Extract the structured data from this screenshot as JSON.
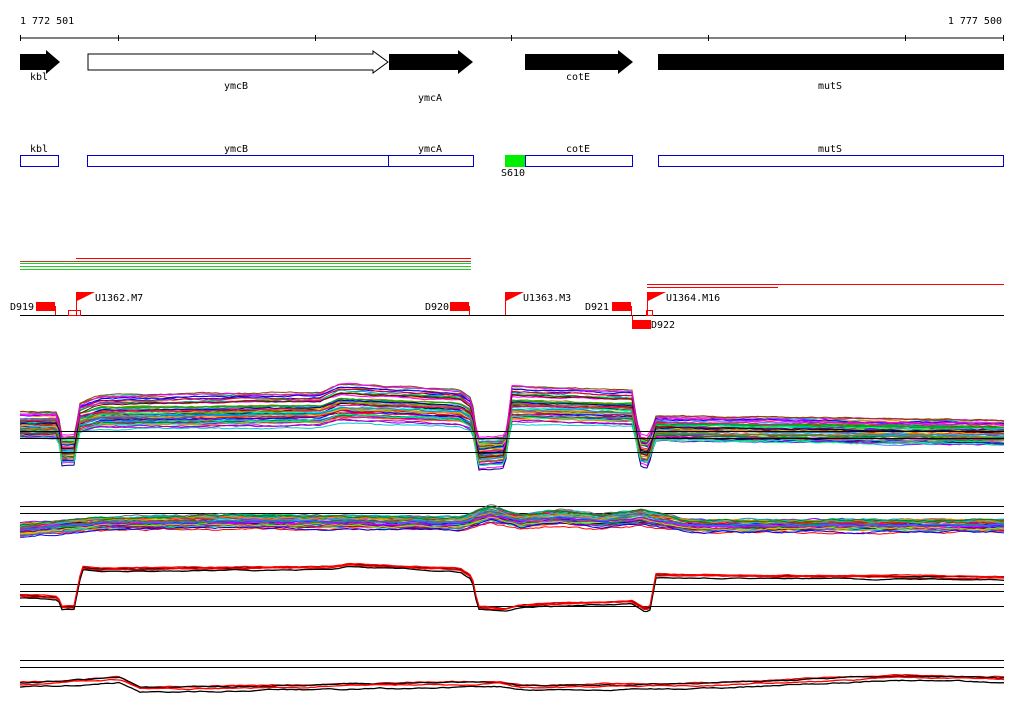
{
  "coordinate_axis": {
    "start_label": "1 772 501",
    "end_label": "1 777 500",
    "start": 1772501,
    "end": 1777500
  },
  "genes": [
    {
      "name": "kbl",
      "filled": true,
      "strand": "+"
    },
    {
      "name": "ymcB",
      "filled": false,
      "strand": "+"
    },
    {
      "name": "ymcA",
      "filled": true,
      "strand": "+"
    },
    {
      "name": "cotE",
      "filled": true,
      "strand": "+"
    },
    {
      "name": "mutS",
      "filled": true,
      "strand": "+"
    }
  ],
  "gene_boxes": [
    {
      "name": "kbl"
    },
    {
      "name": "ymcB"
    },
    {
      "name": "ymcA"
    },
    {
      "name": "cotE"
    },
    {
      "name": "mutS"
    }
  ],
  "promoter": {
    "name": "S610",
    "color": "#00ee00"
  },
  "features": [
    {
      "name": "D919",
      "kind": "terminator"
    },
    {
      "name": "U1362.M7",
      "kind": "flag"
    },
    {
      "name": "D920",
      "kind": "terminator"
    },
    {
      "name": "U1363.M3",
      "kind": "flag"
    },
    {
      "name": "D921",
      "kind": "terminator"
    },
    {
      "name": "D922",
      "kind": "terminator"
    },
    {
      "name": "U1364.M16",
      "kind": "flag"
    }
  ],
  "colors": {
    "feature_red": "#ff0000",
    "box_blue": "#0000cc",
    "promoter_green": "#00ee00",
    "transcript_green": "#22cc22"
  },
  "tracks": [
    {
      "id": "expression-profiles-multi"
    },
    {
      "id": "variance-profiles-multi"
    },
    {
      "id": "expression-summary"
    },
    {
      "id": "variance-summary"
    }
  ]
}
